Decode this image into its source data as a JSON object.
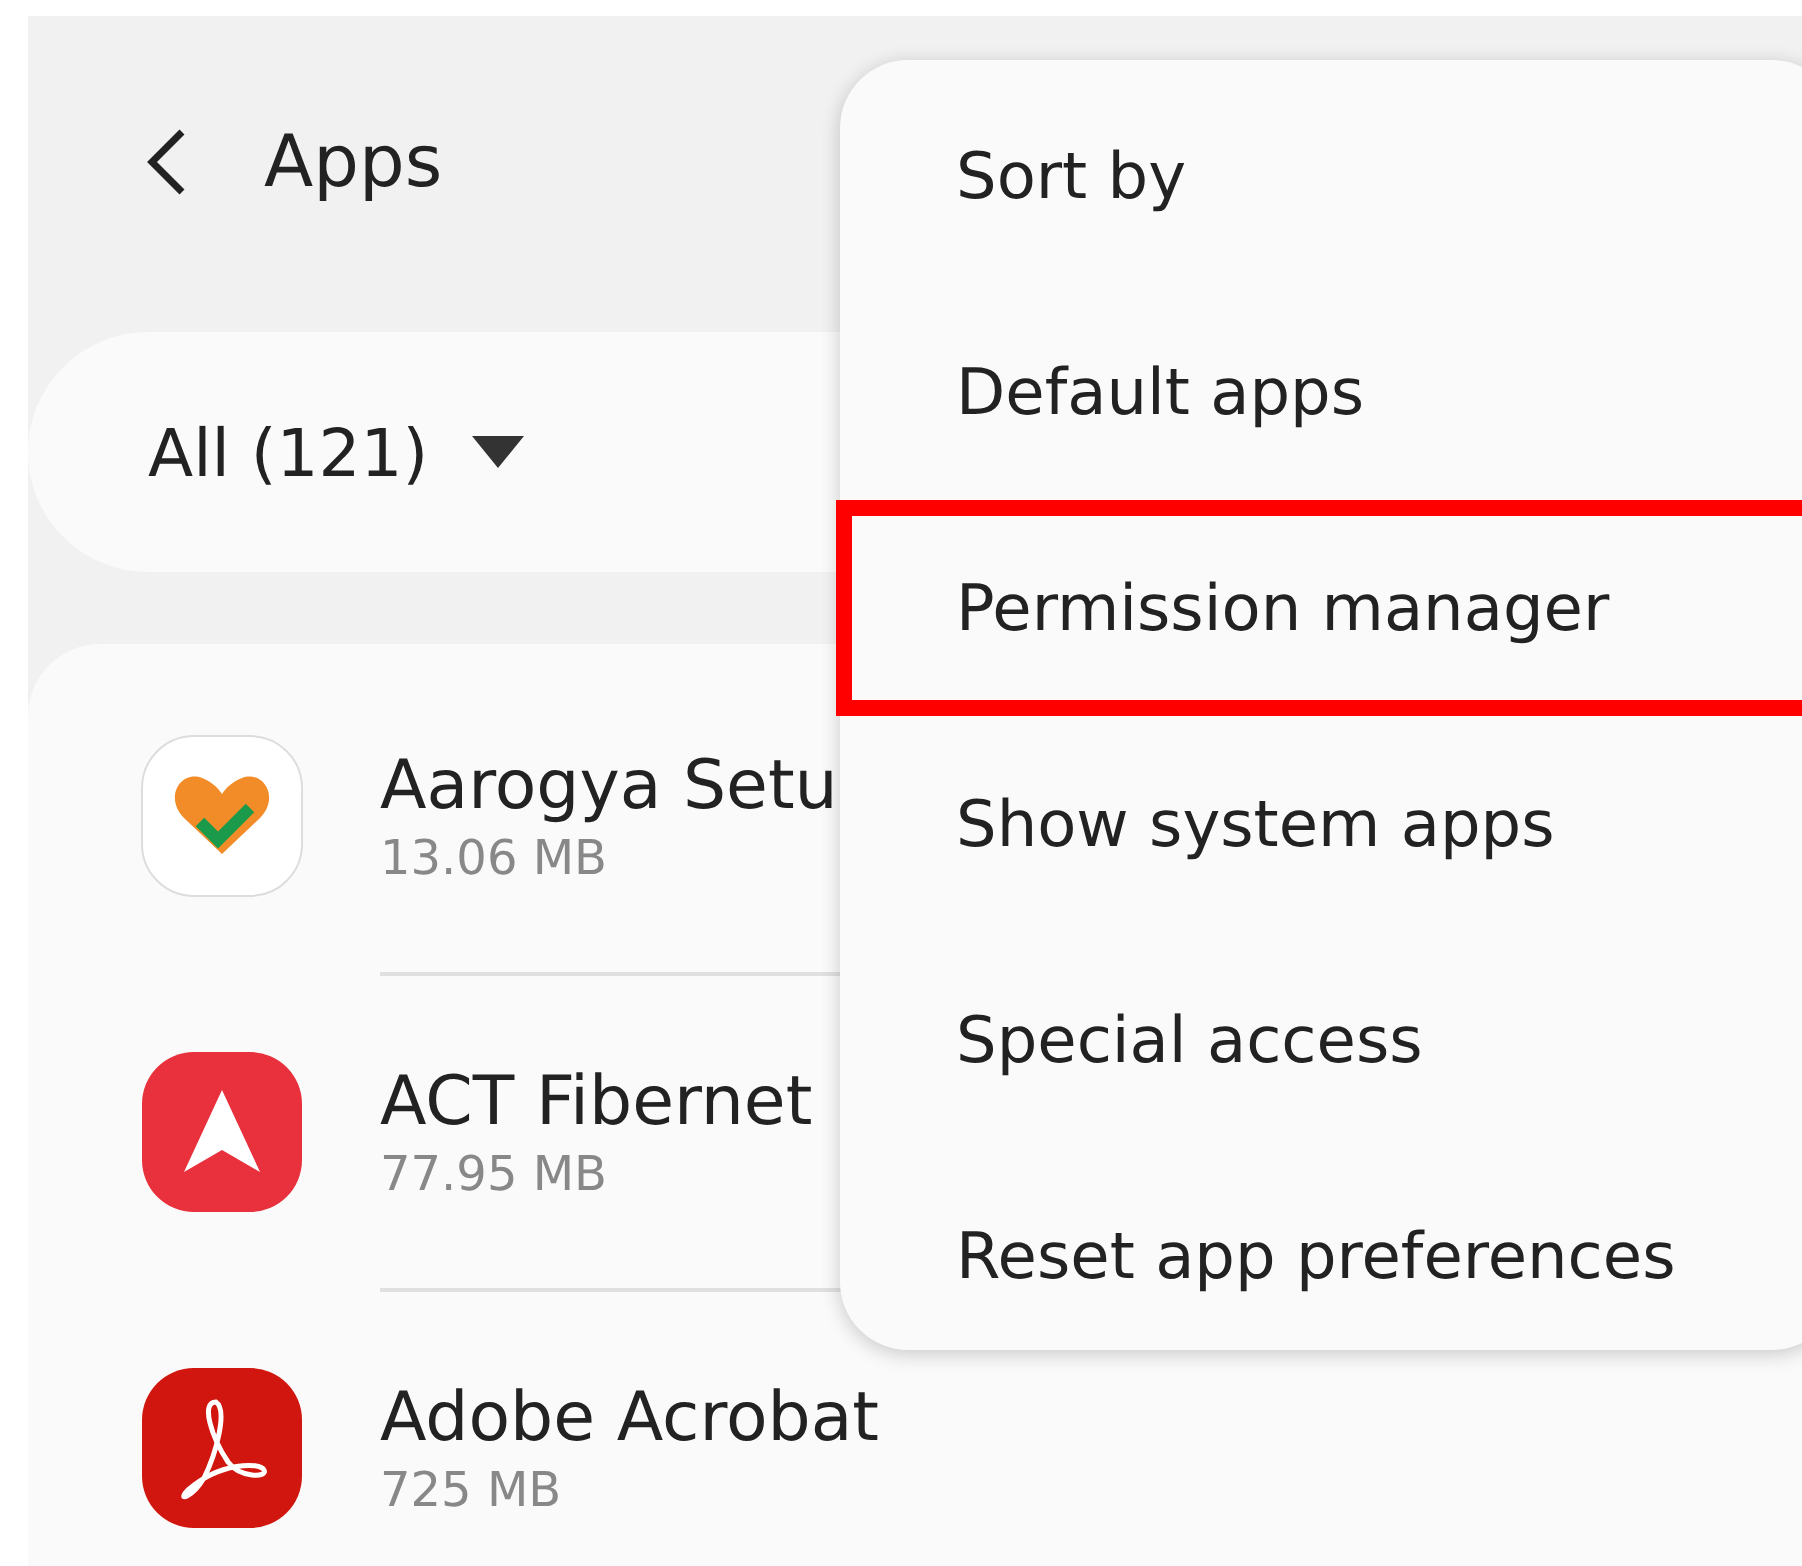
{
  "header": {
    "title": "Apps"
  },
  "filter": {
    "label": "All (121)"
  },
  "apps": [
    {
      "name": "Aarogya Setu",
      "size": "13.06 MB",
      "kind": "heart"
    },
    {
      "name": "ACT Fibernet",
      "size": "77.95 MB",
      "kind": "arrow"
    },
    {
      "name": "Adobe Acrobat",
      "size": "725 MB",
      "kind": "acrobat"
    }
  ],
  "menu": {
    "items": [
      {
        "label": "Sort by",
        "highlighted": false
      },
      {
        "label": "Default apps",
        "highlighted": false
      },
      {
        "label": "Permission manager",
        "highlighted": true
      },
      {
        "label": "Show system apps",
        "highlighted": false
      },
      {
        "label": "Special access",
        "highlighted": false
      },
      {
        "label": "Reset app preferences",
        "highlighted": false
      }
    ]
  }
}
